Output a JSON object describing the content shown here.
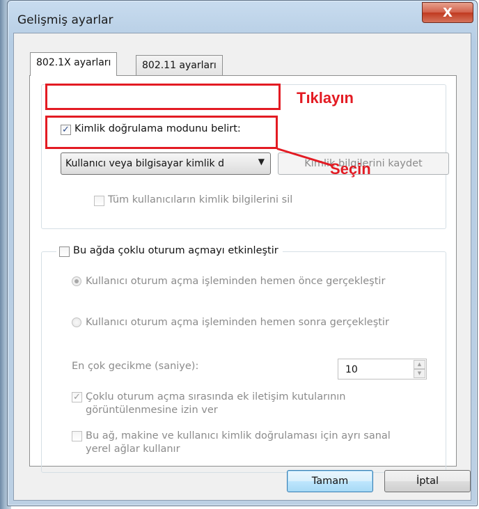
{
  "window": {
    "title": "Gelişmiş ayarlar",
    "close_label": "X"
  },
  "tabs": [
    {
      "label": "802.1X ayarları",
      "active": true
    },
    {
      "label": "802.11 ayarları",
      "active": false
    }
  ],
  "auth": {
    "specify_mode_label": "Kimlik doğrulama modunu belirt:",
    "specify_mode_checked": true,
    "mode_value": "Kullanıcı veya bilgisayar kimlik d",
    "save_credentials_label": "Kimlik bilgilerini kaydet",
    "delete_all_label": "Tüm kullanıcıların kimlik bilgilerini sil"
  },
  "sso": {
    "enable_label": "Bu ağda çoklu oturum açmayı etkinleştir",
    "enable_checked": false,
    "before_logon_label": "Kullanıcı oturum açma işleminden hemen önce gerçekleştir",
    "after_logon_label": "Kullanıcı oturum açma işleminden hemen sonra gerçekleştir",
    "max_delay_label": "En çok gecikme (saniye):",
    "max_delay_value": "10",
    "allow_dialogs_label_1": "Çoklu oturum açma sırasında ek iletişim kutularının",
    "allow_dialogs_label_2": "görüntülenmesine izin ver",
    "allow_dialogs_checked": true,
    "separate_vlan_label_1": "Bu ağ, makine ve kullanıcı kimlik doğrulaması için ayrı sanal",
    "separate_vlan_label_2": "yerel ağlar kullanır",
    "separate_vlan_checked": false
  },
  "buttons": {
    "ok": "Tamam",
    "cancel": "İptal"
  },
  "annotations": {
    "click": "Tıklayın",
    "select": "Seçin",
    "color": "#e31b23"
  },
  "icons": {
    "check": "✓",
    "dropdown": "▼",
    "spin_up": "▲",
    "spin_down": "▼"
  }
}
